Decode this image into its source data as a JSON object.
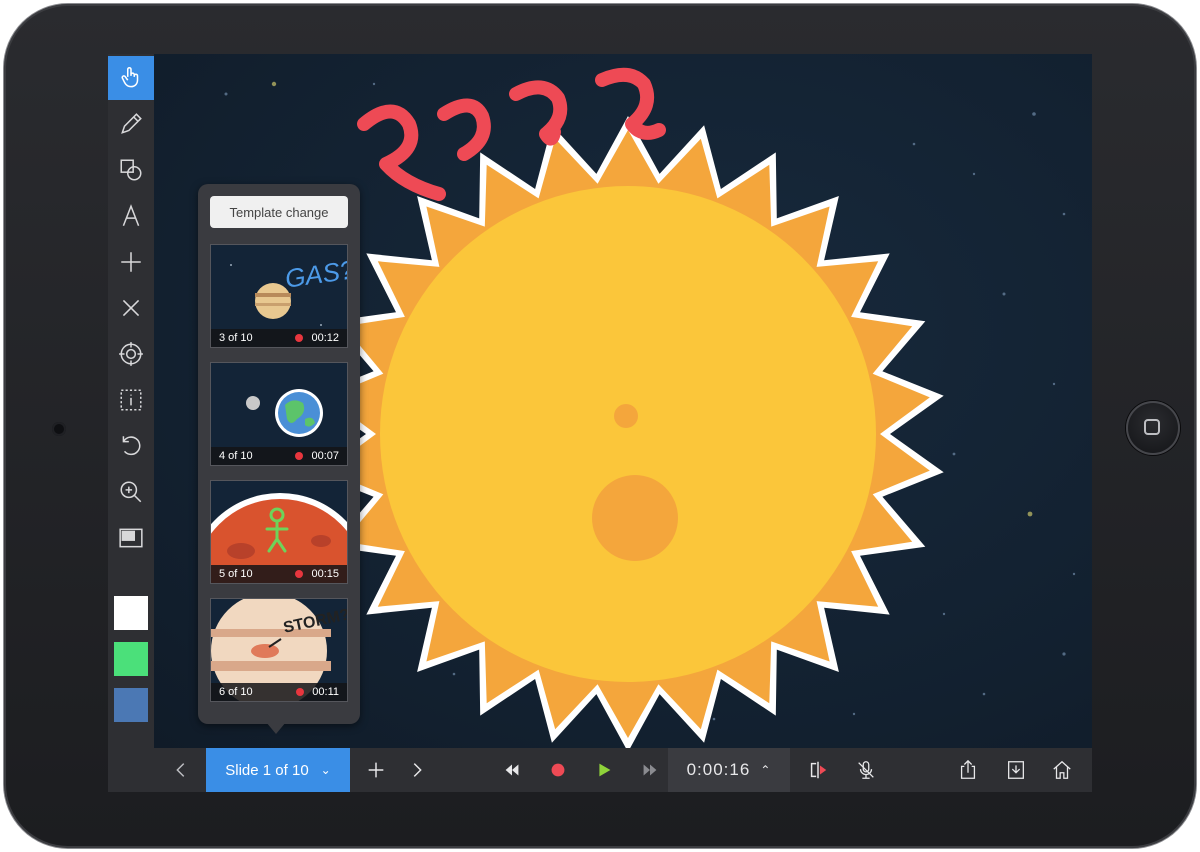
{
  "toolbar": {
    "tools": [
      {
        "icon": "hand-pointer-icon",
        "active": true
      },
      {
        "icon": "pencil-icon",
        "active": false
      },
      {
        "icon": "shapes-icon",
        "active": false
      },
      {
        "icon": "text-icon",
        "active": false
      },
      {
        "icon": "plus-icon",
        "active": false
      },
      {
        "icon": "close-icon",
        "active": false
      },
      {
        "icon": "crosshair-icon",
        "active": false
      },
      {
        "icon": "info-box-icon",
        "active": false
      },
      {
        "icon": "undo-icon",
        "active": false
      },
      {
        "icon": "zoom-icon",
        "active": false
      },
      {
        "icon": "layout-icon",
        "active": false
      }
    ],
    "swatches": [
      "#ffffff",
      "#4be07a",
      "#4b78b4"
    ]
  },
  "panel": {
    "template_label": "Template change",
    "thumbnails": [
      {
        "label": "3 of 10",
        "duration": "00:12",
        "scribble": "GAS?"
      },
      {
        "label": "4 of 10",
        "duration": "00:07"
      },
      {
        "label": "5 of 10",
        "duration": "00:15"
      },
      {
        "label": "6 of 10",
        "duration": "00:11",
        "scribble": "STORM?"
      }
    ]
  },
  "bottombar": {
    "slide_label": "Slide 1 of 10",
    "timer": "0:00:16"
  },
  "canvas": {
    "scribble": "????",
    "colors": {
      "sun_inner": "#fbc63a",
      "sun_outer": "#f4a63c",
      "scribble": "#ee4a55"
    }
  }
}
